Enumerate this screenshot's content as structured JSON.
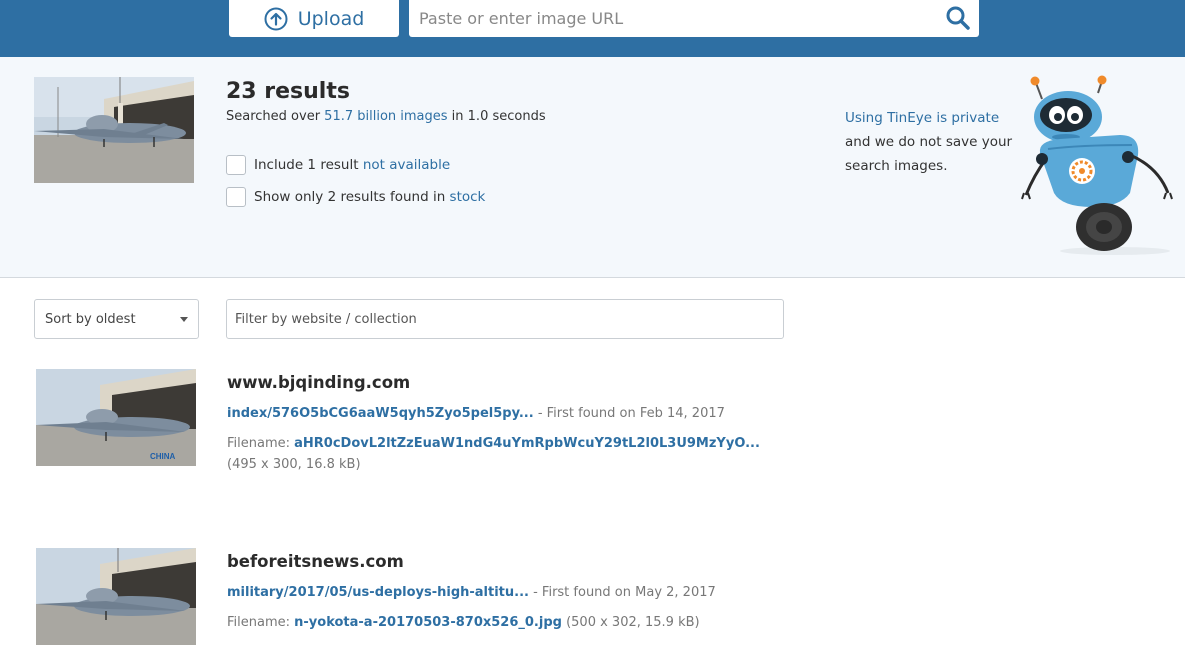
{
  "header": {
    "upload_label": "Upload",
    "url_placeholder": "Paste or enter image URL",
    "accent": "#2e6fa3"
  },
  "summary": {
    "results_count": "23 results",
    "searched_prefix": "Searched over ",
    "searched_count": "51.7 billion images",
    "searched_suffix": " in 1.0 seconds",
    "option1_text": "Include 1 result ",
    "option1_link": "not available",
    "option2_text": "Show only 2 results found in ",
    "option2_link": "stock",
    "privacy_link": "Using TinEye is private",
    "privacy_text": "and we do not save your search images."
  },
  "controls": {
    "sort_value": "Sort by oldest",
    "filter_placeholder": "Filter by website / collection"
  },
  "results": [
    {
      "domain": "www.bjqinding.com",
      "path": "index/576O5bCG6aaW5qyh5Zyo5pel5py...",
      "first_found": " - First found on Feb 14, 2017",
      "filename_label": "Filename: ",
      "filename": "aHR0cDovL2ltZzEuaW1ndG4uYmRpbWcuY29tL2l0L3U9MzYyO...",
      "details": "(495 x 300, 16.8 kB)"
    },
    {
      "domain": "beforeitsnews.com",
      "path": "military/2017/05/us-deploys-high-altitu...",
      "first_found": " - First found on May 2, 2017",
      "filename_label": "Filename: ",
      "filename": "n-yokota-a-20170503-870x526_0.jpg",
      "details": " (500 x 302, 15.9 kB)"
    }
  ],
  "thumb_watermark": "CHINA"
}
